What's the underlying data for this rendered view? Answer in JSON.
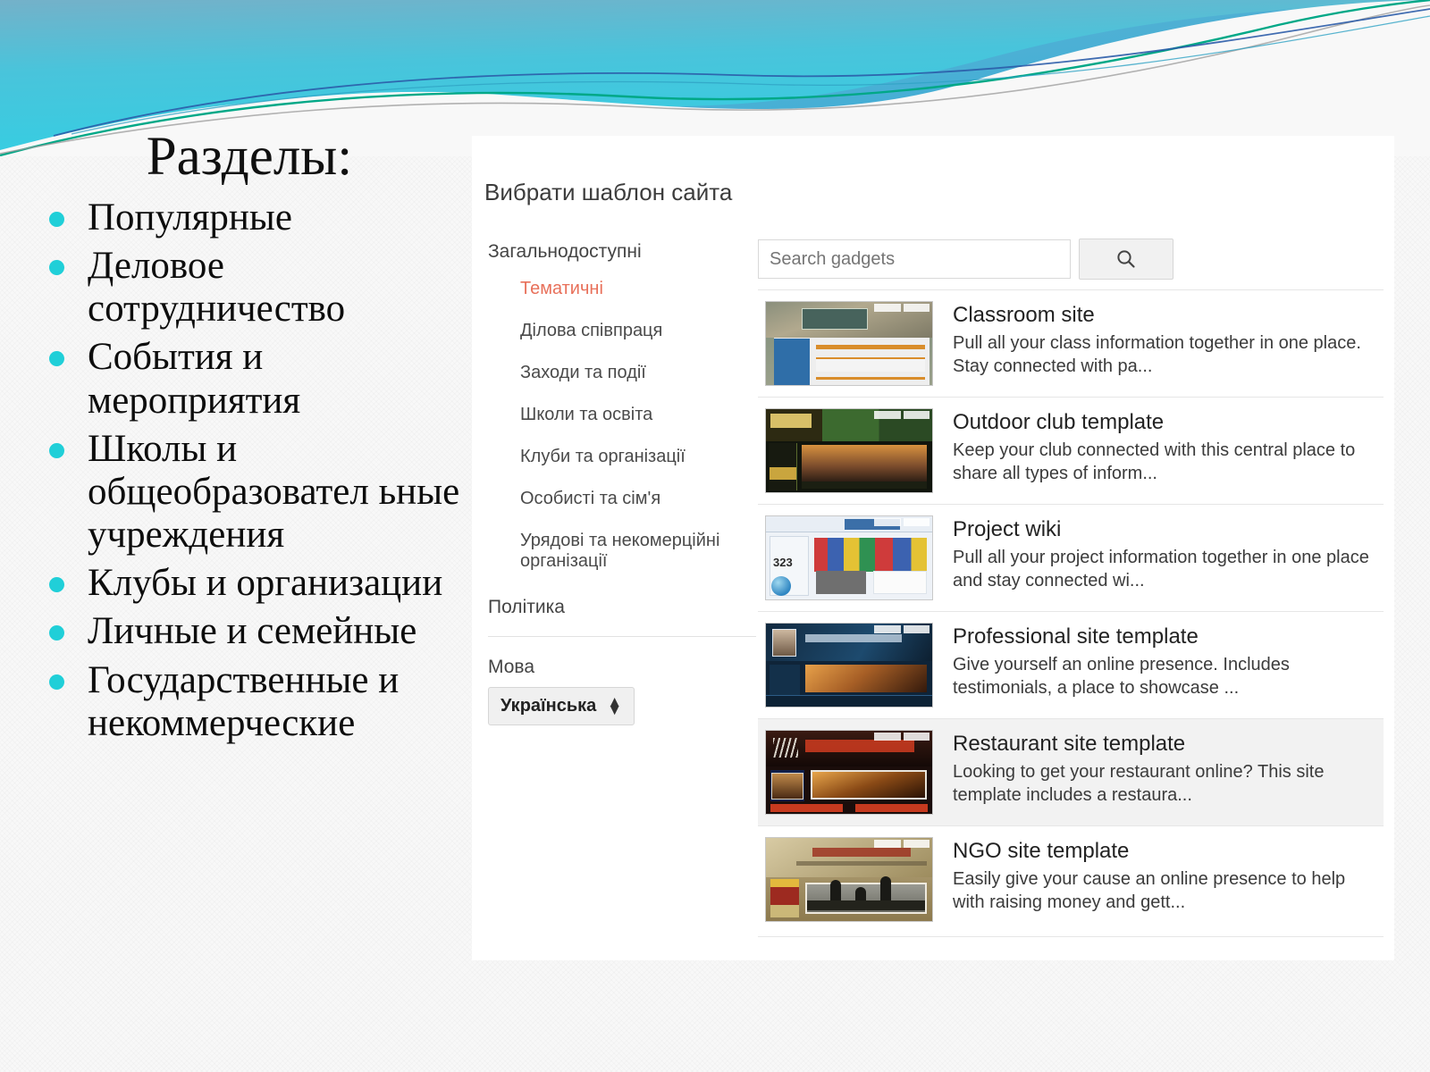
{
  "slide": {
    "title": "Разделы:",
    "bullets": [
      "Популярные",
      "Деловое сотрудничество",
      "События и мероприятия",
      "Школы и общеобразовател ьные учреждения",
      "Клубы и организации",
      "Личные и семейные",
      "Государственные и некоммерческие"
    ],
    "bullet_color": "#20cfd8",
    "banner_colors": {
      "sky_top": "#7fb6cd",
      "cyan": "#3fc9dd",
      "teal_line": "#00a887",
      "blue_line": "#2b5ca8",
      "grey_line": "#9a9a9a"
    }
  },
  "screenshot": {
    "heading": "Вибрати шаблон сайта",
    "nav": {
      "top_label": "Загальнодоступні",
      "items": [
        {
          "label": "Тематичні",
          "selected": true
        },
        {
          "label": "Ділова співпраця",
          "selected": false
        },
        {
          "label": "Заходи та події",
          "selected": false
        },
        {
          "label": "Школи та освіта",
          "selected": false
        },
        {
          "label": "Клуби та організації",
          "selected": false
        },
        {
          "label": "Особисті та сім'я",
          "selected": false
        },
        {
          "label": "Урядові та некомерційні організації",
          "selected": false
        }
      ],
      "policy_label": "Політика",
      "language_label": "Мова",
      "language_value": "Українська",
      "selected_color": "#e8705a"
    },
    "search": {
      "placeholder": "Search gadgets",
      "value": "",
      "button_icon": "search-icon"
    },
    "templates": [
      {
        "title": "Classroom site",
        "description": "Pull all your class information together in one place. Stay connected with pa...",
        "thumb": "classroom-thumbnail",
        "highlighted": false
      },
      {
        "title": "Outdoor club template",
        "description": "Keep your club connected with this central place to share all types of inform...",
        "thumb": "outdoor-club-thumbnail",
        "highlighted": false
      },
      {
        "title": "Project wiki",
        "description": "Pull all your project information together in one place and stay connected wi...",
        "thumb": "project-wiki-thumbnail",
        "highlighted": false
      },
      {
        "title": "Professional site template",
        "description": "Give yourself an online presence. Includes testimonials, a place to showcase ...",
        "thumb": "professional-thumbnail",
        "highlighted": false
      },
      {
        "title": "Restaurant site template",
        "description": "Looking to get your restaurant online? This site template includes a restaura...",
        "thumb": "restaurant-thumbnail",
        "highlighted": true
      },
      {
        "title": "NGO site template",
        "description": "Easily give your cause an online presence to help with raising money and gett...",
        "thumb": "ngo-thumbnail",
        "highlighted": false
      }
    ]
  }
}
